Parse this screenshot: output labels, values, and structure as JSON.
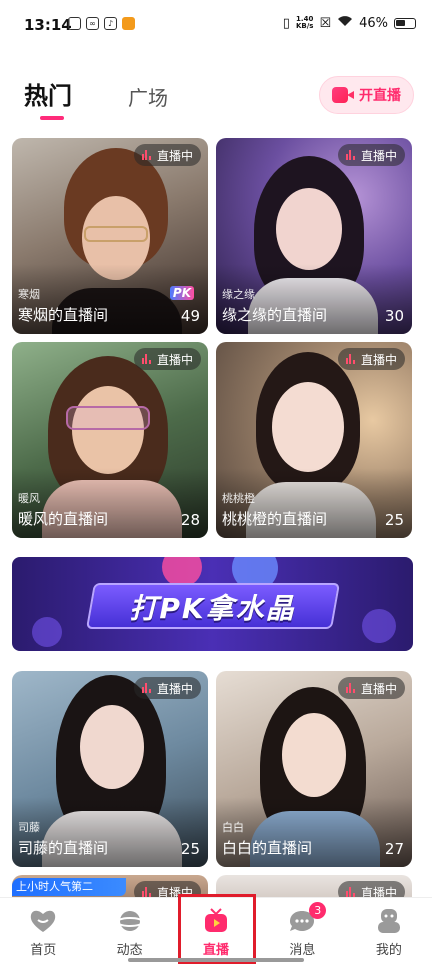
{
  "status_bar": {
    "time": "13:14",
    "net_speed_value": "1.40",
    "net_speed_unit": "KB/s",
    "battery": "46%"
  },
  "header": {
    "tabs": [
      {
        "label": "热门",
        "active": true
      },
      {
        "label": "广场",
        "active": false
      }
    ],
    "go_live_label": "开直播"
  },
  "live_badge": "直播中",
  "rooms": [
    {
      "host": "寒烟",
      "title": "寒烟的直播间",
      "viewers": "49"
    },
    {
      "host": "缘之缘",
      "title": "缘之缘的直播间",
      "viewers": "30"
    },
    {
      "host": "暖风",
      "title": "暖风的直播间",
      "viewers": "28"
    },
    {
      "host": "桃桃橙",
      "title": "桃桃橙的直播间",
      "viewers": "25"
    },
    {
      "host": "司藤",
      "title": "司藤的直播间",
      "viewers": "25"
    },
    {
      "host": "白白",
      "title": "白白的直播间",
      "viewers": "27"
    }
  ],
  "pk_tag": "PK",
  "banner_text": "打PK拿水晶",
  "rank_tag": "上小时人气第二",
  "bottom_nav": {
    "items": [
      {
        "label": "首页",
        "icon": "home-heart-icon"
      },
      {
        "label": "动态",
        "icon": "planet-icon"
      },
      {
        "label": "直播",
        "icon": "tv-icon",
        "active": true
      },
      {
        "label": "消息",
        "icon": "chat-bubble-icon",
        "badge": "3"
      },
      {
        "label": "我的",
        "icon": "profile-icon"
      }
    ]
  },
  "colors": {
    "accent": "#ff2b6d",
    "live_dot": "#ff4d6d",
    "highlight_box": "#e01c2b"
  }
}
